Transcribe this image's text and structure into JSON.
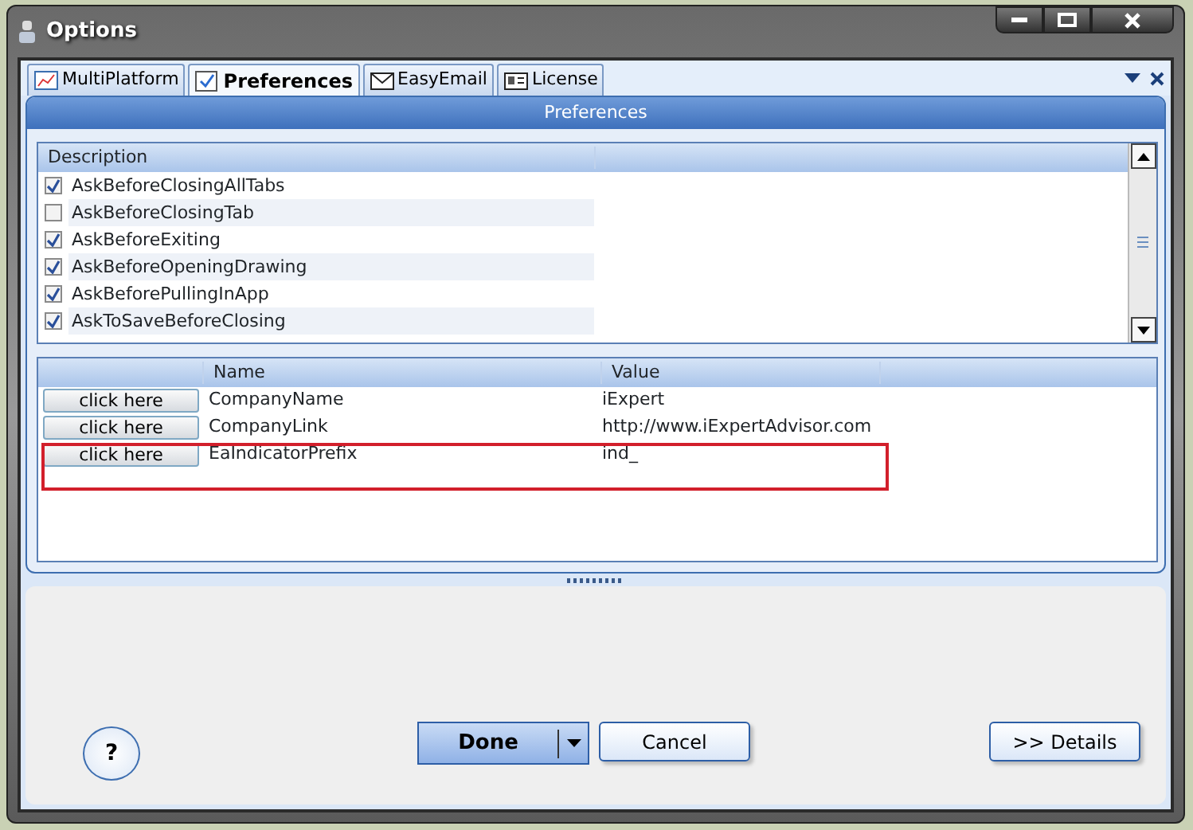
{
  "window": {
    "title": "Options"
  },
  "tabs": [
    {
      "label": "MultiPlatform",
      "selected": false,
      "kind": "chart"
    },
    {
      "label": "Preferences",
      "selected": true,
      "kind": "check"
    },
    {
      "label": "EasyEmail",
      "selected": false,
      "kind": "mail"
    },
    {
      "label": "License",
      "selected": false,
      "kind": "card"
    }
  ],
  "panel": {
    "title": "Preferences"
  },
  "options_list": {
    "columns": [
      "Description"
    ],
    "rows": [
      {
        "label": "AskBeforeClosingAllTabs",
        "checked": true
      },
      {
        "label": "AskBeforeClosingTab",
        "checked": false
      },
      {
        "label": "AskBeforeExiting",
        "checked": true
      },
      {
        "label": "AskBeforeOpeningDrawing",
        "checked": true
      },
      {
        "label": "AskBeforePullingInApp",
        "checked": true
      },
      {
        "label": "AskToSaveBeforeClosing",
        "checked": true
      }
    ]
  },
  "settings_table": {
    "columns": [
      "Name",
      "Value"
    ],
    "rows": [
      {
        "button": "click here",
        "name": "CompanyName",
        "value": "iExpert"
      },
      {
        "button": "click here",
        "name": "CompanyLink",
        "value": "http://www.iExpertAdvisor.com"
      },
      {
        "button": "click here",
        "name": "EaIndicatorPrefix",
        "value": "ind_"
      }
    ]
  },
  "buttons": {
    "help": "?",
    "done": "Done",
    "cancel": "Cancel",
    "details": ">> Details"
  }
}
